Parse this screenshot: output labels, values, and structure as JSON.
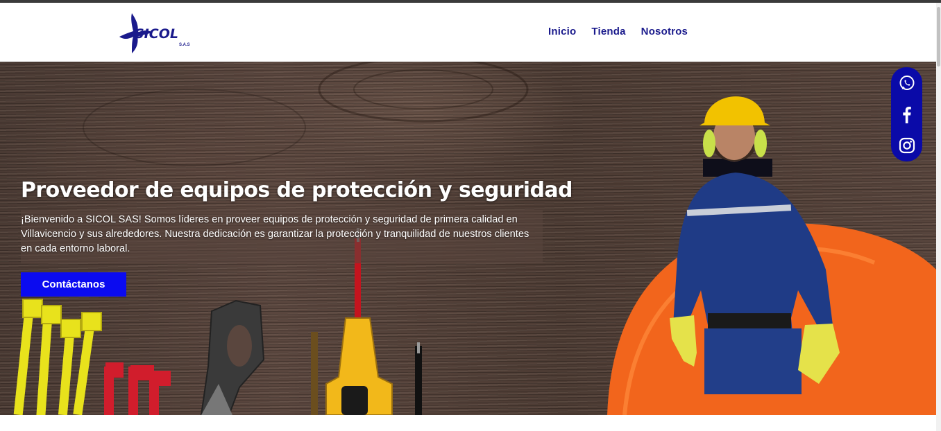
{
  "brand": {
    "name": "SICOL",
    "suffix": "S.A.S"
  },
  "nav": {
    "items": [
      "Inicio",
      "Tienda",
      "Nosotros"
    ]
  },
  "hero": {
    "title": "Proveedor de equipos de protección y seguridad",
    "description": "¡Bienvenido a SICOL SAS! Somos líderes en proveer equipos de protección y seguridad de primera calidad en Villavicencio y sus alrededores. Nuestra dedicación es garantizar la protección y tranquilidad de nuestros clientes en cada entorno laboral.",
    "cta_label": "Contáctanos"
  },
  "social": {
    "items": [
      "whatsapp-icon",
      "facebook-icon",
      "instagram-icon"
    ]
  },
  "colors": {
    "brand": "#1a1a8c",
    "cta": "#0b0bf0",
    "social_bar": "#0a0aa8",
    "hero_wood": "#4a3a33"
  }
}
